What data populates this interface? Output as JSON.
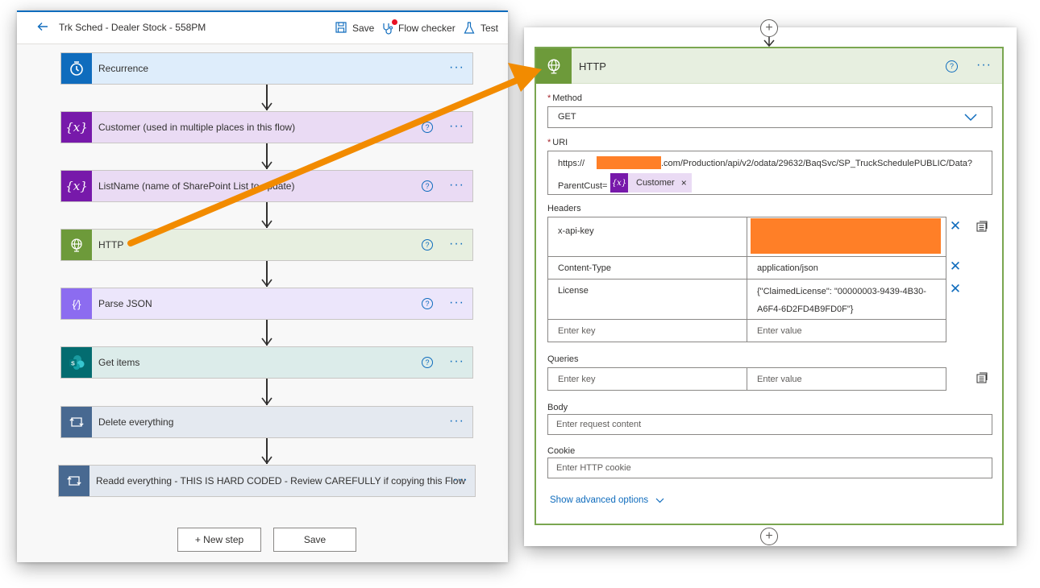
{
  "topbar": {
    "title": "Trk Sched - Dealer Stock - 558PM",
    "save_label": "Save",
    "flow_checker_label": "Flow checker",
    "test_label": "Test"
  },
  "steps": [
    {
      "label": "Recurrence",
      "icon": "clock-icon",
      "color": "#0f6cbd",
      "bg": "#deedfb"
    },
    {
      "label": "Customer (used in multiple places in this flow)",
      "icon": "variable-icon",
      "color": "#7719aa",
      "bg": "#eadbf4"
    },
    {
      "label": "ListName (name of SharePoint List to update)",
      "icon": "variable-icon",
      "color": "#7719aa",
      "bg": "#eadbf4"
    },
    {
      "label": "HTTP",
      "icon": "globe-icon",
      "color": "#6d9a3a",
      "bg": "#e7efe0"
    },
    {
      "label": "Parse JSON",
      "icon": "json-icon",
      "color": "#8c6cf0",
      "bg": "#ece6fb"
    },
    {
      "label": "Get items",
      "icon": "sharepoint-icon",
      "color": "#036c70",
      "bg": "#dcecea"
    },
    {
      "label": "Delete everything",
      "icon": "loop-icon",
      "color": "#486991",
      "bg": "#e4e9f0"
    },
    {
      "label": "Readd everything - THIS IS HARD CODED - Review CAREFULLY if copying this Flow",
      "icon": "loop-icon",
      "color": "#486991",
      "bg": "#e4e9f0"
    }
  ],
  "bottom": {
    "new_step_label": "+ New step",
    "save_label": "Save"
  },
  "http": {
    "title": "HTTP",
    "method_label": "Method",
    "method_value": "GET",
    "uri_label": "URI",
    "uri_prefix": "https://",
    "uri_suffix": ".com/Production/api/v2/odata/29632/BaqSvc/SP_TruckSchedulePUBLIC/Data?",
    "uri_param": "ParentCust=",
    "uri_token": "Customer",
    "headers_label": "Headers",
    "headers": [
      {
        "key": "x-api-key",
        "value": ""
      },
      {
        "key": "Content-Type",
        "value": "application/json"
      },
      {
        "key": "License",
        "value": "{\"ClaimedLicense\": \"00000003-9439-4B30-A6F4-6D2FD4B9FD0F\"}"
      }
    ],
    "key_placeholder": "Enter key",
    "value_placeholder": "Enter value",
    "queries_label": "Queries",
    "body_label": "Body",
    "body_placeholder": "Enter request content",
    "cookie_label": "Cookie",
    "cookie_placeholder": "Enter HTTP cookie",
    "advanced_label": "Show advanced options"
  },
  "colors": {
    "accent": "#0f6cbd",
    "redaction": "#ff7f27",
    "callout_arrow": "#f28b00",
    "http_green": "#6d9a3a"
  }
}
